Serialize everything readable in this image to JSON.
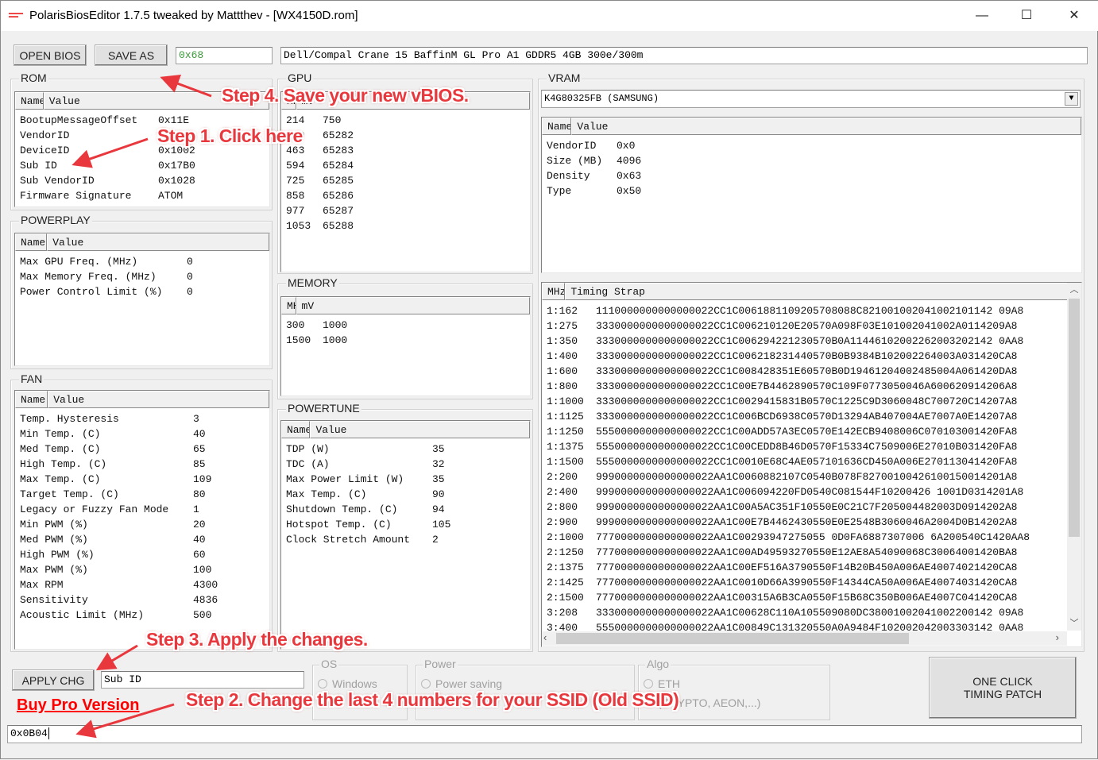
{
  "window": {
    "title": "PolarisBiosEditor 1.7.5 tweaked by Mattthev  - [WX4150D.rom]",
    "icon": "mining-bios-logo",
    "minimize": "—",
    "maximize": "☐",
    "close": "✕"
  },
  "toolbar": {
    "open_label": "OPEN BIOS",
    "save_label": "SAVE AS",
    "checksum": "0x68",
    "bios_name": "Dell/Compal Crane 15 BaffinM GL Pro A1 GDDR5 4GB 300e/300m"
  },
  "rom": {
    "label": "ROM",
    "columns": [
      "Name",
      "Value"
    ],
    "rows": [
      [
        "BootupMessageOffset",
        "0x11E"
      ],
      [
        "VendorID",
        "0x1002"
      ],
      [
        "DeviceID",
        "0x1002"
      ],
      [
        "Sub ID",
        "0x17B0"
      ],
      [
        "Sub VendorID",
        "0x1028"
      ],
      [
        "Firmware Signature",
        "ATOM"
      ]
    ]
  },
  "powerplay": {
    "label": "POWERPLAY",
    "columns": [
      "Name",
      "Value"
    ],
    "rows": [
      [
        "Max GPU Freq. (MHz)",
        "0"
      ],
      [
        "Max Memory Freq. (MHz)",
        "0"
      ],
      [
        "Power Control Limit (%)",
        "0"
      ]
    ]
  },
  "fan": {
    "label": "FAN",
    "columns": [
      "Name",
      "Value"
    ],
    "rows": [
      [
        "Temp. Hysteresis",
        "3"
      ],
      [
        "Min Temp. (C)",
        "40"
      ],
      [
        "Med Temp. (C)",
        "65"
      ],
      [
        "High Temp. (C)",
        "85"
      ],
      [
        "Max Temp. (C)",
        "109"
      ],
      [
        "Target Temp. (C)",
        "80"
      ],
      [
        "Legacy or Fuzzy Fan Mode",
        "1"
      ],
      [
        "Min PWM (%)",
        "20"
      ],
      [
        "Med PWM (%)",
        "40"
      ],
      [
        "High PWM (%)",
        "60"
      ],
      [
        "Max PWM (%)",
        "100"
      ],
      [
        "Max RPM",
        "4300"
      ],
      [
        "Sensitivity",
        "4836"
      ],
      [
        "Acoustic Limit (MHz)",
        "500"
      ]
    ]
  },
  "gpu": {
    "label": "GPU",
    "columns": [
      "MHz",
      "mV"
    ],
    "rows": [
      [
        "214",
        "750"
      ],
      [
        "300",
        "65282"
      ],
      [
        "463",
        "65283"
      ],
      [
        "594",
        "65284"
      ],
      [
        "725",
        "65285"
      ],
      [
        "858",
        "65286"
      ],
      [
        "977",
        "65287"
      ],
      [
        "1053",
        "65288"
      ]
    ]
  },
  "memory": {
    "label": "MEMORY",
    "columns": [
      "MHz",
      "mV"
    ],
    "rows": [
      [
        "300",
        "1000"
      ],
      [
        "1500",
        "1000"
      ]
    ]
  },
  "powertune": {
    "label": "POWERTUNE",
    "columns": [
      "Name",
      "Value"
    ],
    "rows": [
      [
        "TDP (W)",
        "35"
      ],
      [
        "TDC (A)",
        "32"
      ],
      [
        "Max Power Limit (W)",
        "35"
      ],
      [
        "Max Temp. (C)",
        "90"
      ],
      [
        "Shutdown Temp. (C)",
        "94"
      ],
      [
        "Hotspot Temp. (C)",
        "105"
      ],
      [
        "Clock Stretch Amount",
        "2"
      ]
    ]
  },
  "vram": {
    "label": "VRAM",
    "selected": "K4G80325FB (SAMSUNG)",
    "columns": [
      "Name",
      "Value"
    ],
    "rows": [
      [
        "VendorID",
        "0x0"
      ],
      [
        "Size (MB)",
        "4096"
      ],
      [
        "Density",
        "0x63"
      ],
      [
        "Type",
        "0x50"
      ]
    ]
  },
  "timings": {
    "columns": [
      "MHz",
      "Timing Strap"
    ],
    "rows": [
      [
        "1:162",
        "1110000000000000022CC1C0061881109205708088C821001002041002101142 09A8"
      ],
      [
        "1:275",
        "3330000000000000022CC1C006210120E20570A098F03E101002041002A0114209A8"
      ],
      [
        "1:350",
        "3330000000000000022CC1C006294221230570B0A11446102002262003202142 0AA8"
      ],
      [
        "1:400",
        "3330000000000000022CC1C006218231440570B0B9384B102002264003A031420CA8"
      ],
      [
        "1:600",
        "3330000000000000022CC1C008428351E60570B0D19461204002485004A061420DA8"
      ],
      [
        "1:800",
        "3330000000000000022CC1C00E7B4462890570C109F0773050046A600620914206A8"
      ],
      [
        "1:1000",
        "3330000000000000022CC1C0029415831B0570C1225C9D3060048C700720C14207A8"
      ],
      [
        "1:1125",
        "3330000000000000022CC1C006BCD6938C0570D13294AB407004AE7007A0E14207A8"
      ],
      [
        "1:1250",
        "5550000000000000022CC1C00ADD57A3EC0570E142ECB9408006C070103001420FA8"
      ],
      [
        "1:1375",
        "5550000000000000022CC1C00CEDD8B46D0570F15334C7509006E27010B031420FA8"
      ],
      [
        "1:1500",
        "5550000000000000022CC1C0010E68C4AE057101636CD450A006E270113041420FA8"
      ],
      [
        "2:200",
        "9990000000000000022AA1C0060882107C0540B078F82700100426100150014201A8"
      ],
      [
        "2:400",
        "9990000000000000022AA1C006094220FD0540C081544F10200426 1001D0314201A8"
      ],
      [
        "2:800",
        "9990000000000000022AA1C00A5AC351F10550E0C21C7F205004482003D0914202A8"
      ],
      [
        "2:900",
        "9990000000000000022AA1C00E7B4462430550E0E2548B3060046A2004D0B14202A8"
      ],
      [
        "2:1000",
        "7770000000000000022AA1C00293947275055 0D0FA6887307006 6A200540C1420AA8"
      ],
      [
        "2:1250",
        "7770000000000000022AA1C00AD49593270550E12AE8A54090068C30064001420BA8"
      ],
      [
        "2:1375",
        "7770000000000000022AA1C00EF516A3790550F14B20B450A006AE40074021420CA8"
      ],
      [
        "2:1425",
        "7770000000000000022AA1C0010D66A3990550F14344CA50A006AE40074031420CA8"
      ],
      [
        "2:1500",
        "7770000000000000022AA1C00315A6B3CA0550F15B68C350B006AE4007C041420CA8"
      ],
      [
        "3:208",
        "3330000000000000022AA1C00628C110A105509080DC38001002041002200142 09A8"
      ],
      [
        "3:400",
        "5550000000000000022AA1C00849C131320550A0A9484F102002042003303142 0AA8"
      ]
    ]
  },
  "bottom": {
    "apply_label": "APPLY CHG",
    "selected_name": "Sub ID",
    "value_input": "0x0B04",
    "buy_pro": "Buy Pro Version",
    "one_click": "ONE CLICK TIMING PATCH"
  },
  "os": {
    "label": "OS",
    "options": [
      "Windows"
    ]
  },
  "power": {
    "label": "Power",
    "options": [
      "Power saving"
    ]
  },
  "algo": {
    "label": "Algo",
    "options": [
      "ETH",
      "(CRYPTO, AEON,...)"
    ]
  },
  "annotations": {
    "step1": "Step 1. Click here",
    "step2": "Step 2. Change the last 4 numbers for your SSID (Old SSID)",
    "step3": "Step 3. Apply the changes.",
    "step4": "Step 4. Save your new vBIOS.",
    "color": "#e8383d"
  }
}
